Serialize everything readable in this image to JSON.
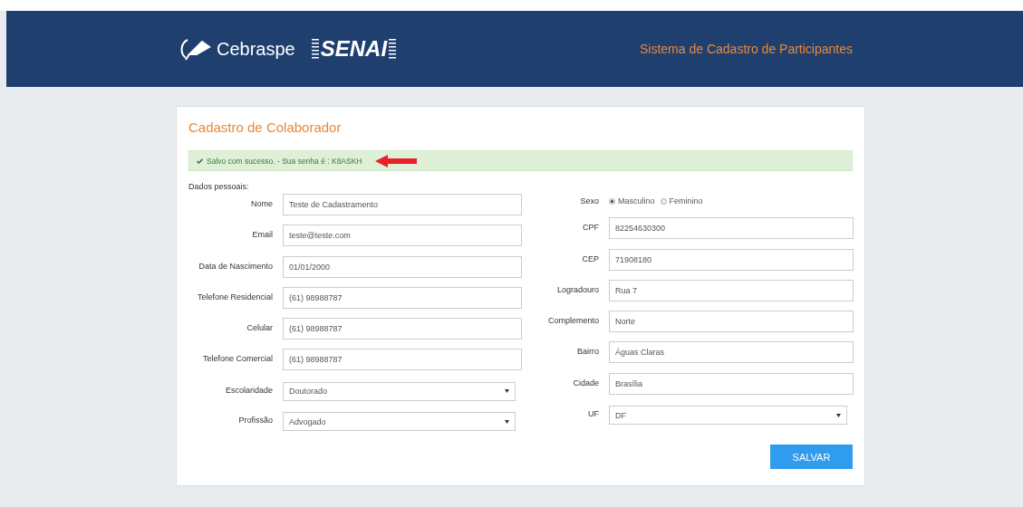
{
  "header": {
    "logos": [
      "Cebraspe",
      "SENAI"
    ],
    "title": "Sistema de Cadastro de Participantes"
  },
  "form": {
    "title": "Cadastro de Colaborador",
    "alert": {
      "message": "Salvo com sucesso. - Sua senha é : K8ASKH"
    },
    "section": "Dados pessoais:",
    "left_fields": [
      {
        "kind": "text",
        "label": "Nome",
        "value": "Teste de Cadastramento"
      },
      {
        "kind": "text",
        "label": "Email",
        "value": "teste@teste.com"
      },
      {
        "kind": "text",
        "label": "Data de Nascimento",
        "value": "01/01/2000"
      },
      {
        "kind": "text",
        "label": "Telefone Residencial",
        "value": "(61) 98988787"
      },
      {
        "kind": "text",
        "label": "Celular",
        "value": "(61) 98988787"
      },
      {
        "kind": "text",
        "label": "Telefone Comercial",
        "value": "(61) 98988787"
      },
      {
        "kind": "select",
        "label": "Escolaridade",
        "value": "Doutorado"
      },
      {
        "kind": "select",
        "label": "Profissão",
        "value": "Advogado"
      }
    ],
    "right_fields": [
      {
        "kind": "radio",
        "label": "Sexo",
        "options": [
          {
            "label": "Masculino",
            "selected": true
          },
          {
            "label": "Feminino",
            "selected": false
          }
        ]
      },
      {
        "kind": "text",
        "label": "CPF",
        "value": "82254630300"
      },
      {
        "kind": "text",
        "label": "CEP",
        "value": "71908180"
      },
      {
        "kind": "text",
        "label": "Logradouro",
        "value": "Rua 7"
      },
      {
        "kind": "text",
        "label": "Complemento",
        "value": "Norte"
      },
      {
        "kind": "text",
        "label": "Bairro",
        "value": "Águas Claras"
      },
      {
        "kind": "text",
        "label": "Cidade",
        "value": "Brasília"
      },
      {
        "kind": "select",
        "label": "UF",
        "value": "DF"
      }
    ],
    "submit": "SALVAR"
  }
}
